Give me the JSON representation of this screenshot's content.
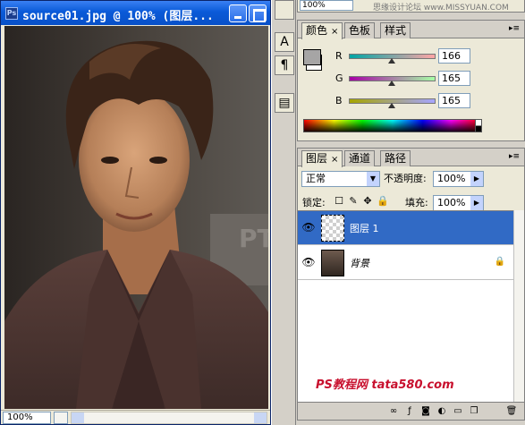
{
  "document": {
    "title": "source01.jpg @ 100% (图层...",
    "app_icon": "Ps",
    "zoom": "100%"
  },
  "toolstrip": {
    "icons": [
      "paragraph-char-icon",
      "pilcrow-icon",
      "notes-icon"
    ],
    "glyphs": [
      "A",
      "¶",
      "▤"
    ]
  },
  "top_strip": {
    "value": "100%",
    "watermark": "思缘设计论坛 www.MISSYUAN.COM"
  },
  "color_panel": {
    "tabs": [
      "颜色",
      "色板",
      "样式"
    ],
    "close": "×",
    "foreground": "#a6a5a5",
    "background": "#ffffff",
    "sliders": [
      {
        "label": "R",
        "value": "166"
      },
      {
        "label": "G",
        "value": "165"
      },
      {
        "label": "B",
        "value": "165"
      }
    ]
  },
  "layers_panel": {
    "tabs": [
      "图层",
      "通道",
      "路径"
    ],
    "close": "×",
    "blend_mode": "正常",
    "opacity_label": "不透明度:",
    "opacity_value": "100%",
    "lock_label": "锁定:",
    "fill_label": "填充:",
    "fill_value": "100%",
    "layers": [
      {
        "name": "图层 1",
        "selected": true,
        "type": "transparent"
      },
      {
        "name": "背景",
        "selected": false,
        "type": "photo",
        "locked": true
      }
    ],
    "watermark": "PS教程网 tata580.com",
    "bottom_icons": [
      "link-icon",
      "fx-icon",
      "mask-icon",
      "adjustment-icon",
      "folder-icon",
      "new-layer-icon",
      "trash-icon"
    ]
  },
  "colors": {
    "title_bar": "#0a5ad8",
    "selection": "#316ac5"
  }
}
